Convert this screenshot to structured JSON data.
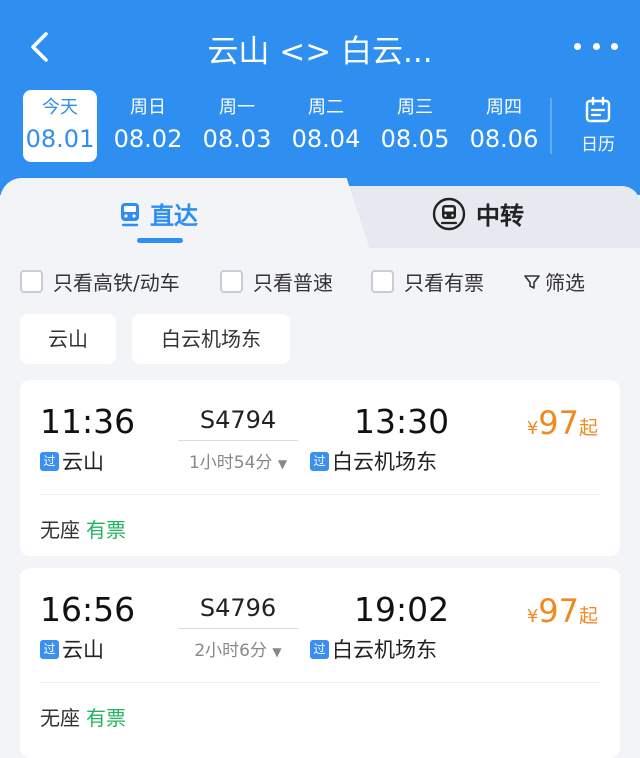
{
  "header": {
    "title": "云山 <> 白云...",
    "back_icon": "back-chevron-icon",
    "more_icon": "more-dots-icon"
  },
  "dates": [
    {
      "label": "今天",
      "value": "08.01",
      "selected": true
    },
    {
      "label": "周日",
      "value": "08.02",
      "selected": false
    },
    {
      "label": "周一",
      "value": "08.03",
      "selected": false
    },
    {
      "label": "周二",
      "value": "08.04",
      "selected": false
    },
    {
      "label": "周三",
      "value": "08.05",
      "selected": false
    },
    {
      "label": "周四",
      "value": "08.06",
      "selected": false
    }
  ],
  "calendar": {
    "label": "日历",
    "icon": "calendar-icon"
  },
  "tabs": {
    "direct": "直达",
    "transfer": "中转"
  },
  "filters": {
    "high_speed": "只看高铁/动车",
    "normal": "只看普速",
    "available": "只看有票",
    "screen": "筛选"
  },
  "station_chips": [
    "云山",
    "白云机场东"
  ],
  "trains": [
    {
      "dep_time": "11:36",
      "arr_time": "13:30",
      "train_no": "S4794",
      "duration": "1小时54分",
      "dep_station": "云山",
      "arr_station": "白云机场东",
      "pass_tag": "过",
      "price_currency": "¥",
      "price": "97",
      "price_suffix": "起",
      "seat": "无座",
      "availability": "有票"
    },
    {
      "dep_time": "16:56",
      "arr_time": "19:02",
      "train_no": "S4796",
      "duration": "2小时6分",
      "dep_station": "云山",
      "arr_station": "白云机场东",
      "pass_tag": "过",
      "price_currency": "¥",
      "price": "97",
      "price_suffix": "起",
      "seat": "无座",
      "availability": "有票"
    }
  ],
  "colors": {
    "brand": "#2f8ff1",
    "price": "#f08a1f",
    "available": "#22b35e"
  }
}
